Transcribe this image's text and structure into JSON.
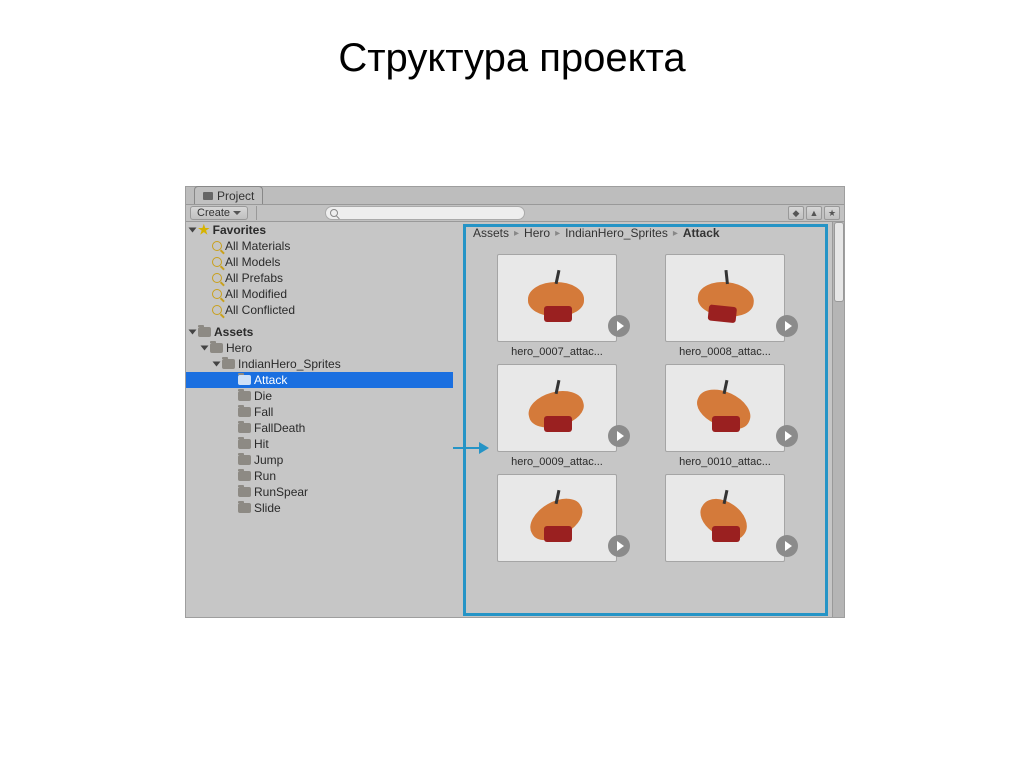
{
  "title": "Структура проекта",
  "tab_label": "Project",
  "create_label": "Create",
  "favorites": {
    "label": "Favorites",
    "items": [
      "All Materials",
      "All Models",
      "All Prefabs",
      "All Modified",
      "All Conflicted"
    ]
  },
  "assets_label": "Assets",
  "hero_label": "Hero",
  "sprites_label": "IndianHero_Sprites",
  "folders": [
    "Attack",
    "Die",
    "Fall",
    "FallDeath",
    "Hit",
    "Jump",
    "Run",
    "RunSpear",
    "Slide"
  ],
  "selected_folder": "Attack",
  "breadcrumb": [
    "Assets",
    "Hero",
    "IndianHero_Sprites",
    "Attack"
  ],
  "grid_items": [
    {
      "label": "hero_0007_attac..."
    },
    {
      "label": "hero_0008_attac..."
    },
    {
      "label": "hero_0009_attac..."
    },
    {
      "label": "hero_0010_attac..."
    },
    {
      "label": ""
    },
    {
      "label": ""
    }
  ]
}
